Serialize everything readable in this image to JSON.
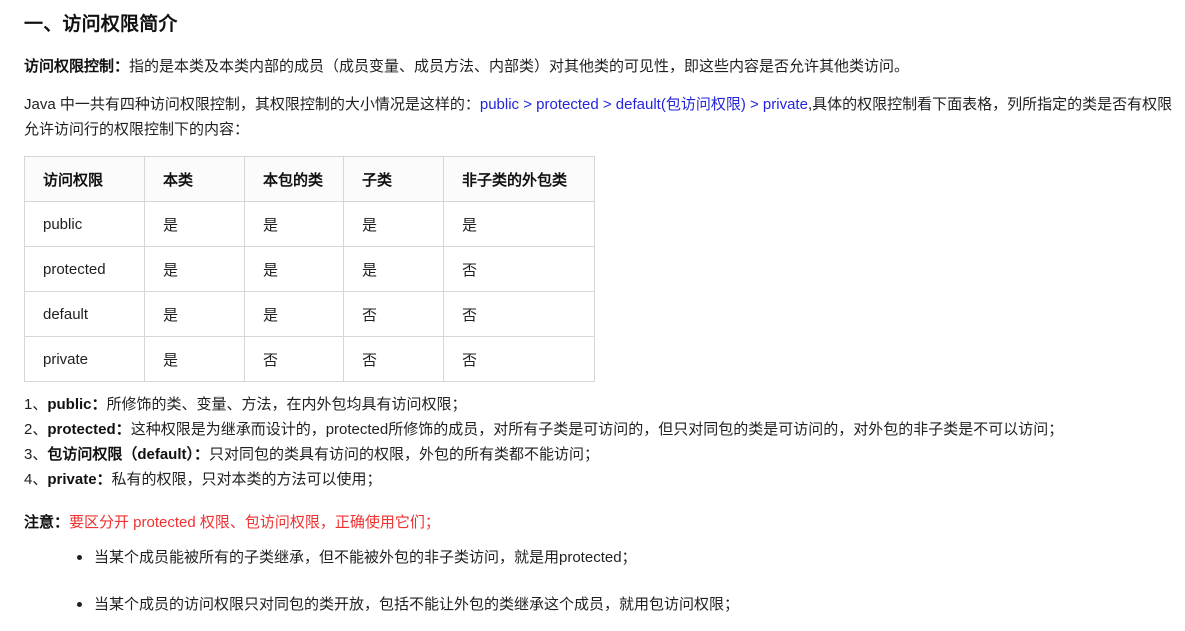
{
  "document": {
    "title": "一、访问权限简介"
  },
  "intro": {
    "label": "访问权限控制：",
    "text": "指的是本类及本类内部的成员（成员变量、成员方法、内部类）对其他类的可见性，即这些内容是否允许其他类访问。"
  },
  "order_para": {
    "lead": "Java 中一共有四种访问权限控制，其权限控制的大小情况是这样的：",
    "chain": "public > protected > default(包访问权限) > private",
    "tail": ",具体的权限控制看下面表格，列所指定的类是否有权限允许访问行的权限控制下的内容：",
    "chain_color": "#2424dd"
  },
  "table": {
    "headers": [
      "访问权限",
      "本类",
      "本包的类",
      "子类",
      "非子类的外包类"
    ],
    "rows": [
      [
        "public",
        "是",
        "是",
        "是",
        "是"
      ],
      [
        "protected",
        "是",
        "是",
        "是",
        "否"
      ],
      [
        "default",
        "是",
        "是",
        "否",
        "否"
      ],
      [
        "private",
        "是",
        "否",
        "否",
        "否"
      ]
    ]
  },
  "numbered": [
    {
      "index": "1、",
      "term": "public：",
      "desc": "所修饰的类、变量、方法，在内外包均具有访问权限；"
    },
    {
      "index": "2、",
      "term": "protected：",
      "desc": "这种权限是为继承而设计的，protected所修饰的成员，对所有子类是可访问的，但只对同包的类是可访问的，对外包的非子类是不可以访问；"
    },
    {
      "index": "3、",
      "term": "包访问权限（default）：",
      "desc": "只对同包的类具有访问的权限，外包的所有类都不能访问；"
    },
    {
      "index": "4、",
      "term": "private：",
      "desc": "私有的权限，只对本类的方法可以使用；"
    }
  ],
  "notice": {
    "label": "注意：",
    "text": "要区分开 protected 权限、包访问权限，正确使用它们；",
    "color": "#f03030"
  },
  "bullets": [
    "当某个成员能被所有的子类继承，但不能被外包的非子类访问，就是用protected；",
    "当某个成员的访问权限只对同包的类开放，包括不能让外包的类继承这个成员，就用包访问权限；"
  ]
}
